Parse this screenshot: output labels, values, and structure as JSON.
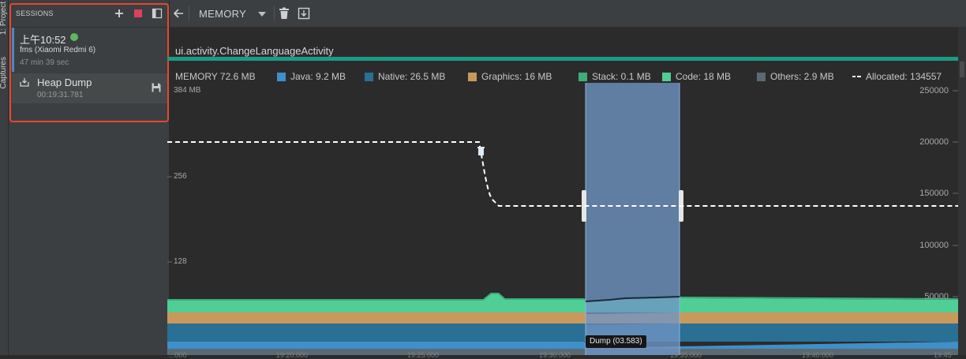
{
  "toolstrip": {
    "tab1": "1: Project",
    "tab2": "Captures"
  },
  "sessions": {
    "title": "SESSIONS",
    "session": {
      "time": "上午10:52",
      "device": "fms (Xiaomi Redmi 6)",
      "duration": "47 min 39 sec"
    },
    "heap_dump": {
      "label": "Heap Dump",
      "timestamp": "00:19:31.781"
    }
  },
  "toolbar": {
    "profiler": "MEMORY"
  },
  "activity": {
    "name": "ui.activity.ChangeLanguageActivity"
  },
  "legend": {
    "total": "MEMORY 72.6 MB",
    "items": [
      {
        "label": "Java: 9.2 MB",
        "color": "#3f8fc9"
      },
      {
        "label": "Native: 26.5 MB",
        "color": "#2a6f94"
      },
      {
        "label": "Graphics: 16 MB",
        "color": "#c9995b"
      },
      {
        "label": "Stack: 0.1 MB",
        "color": "#3cae7a"
      },
      {
        "label": "Code: 18 MB",
        "color": "#4fcf95"
      },
      {
        "label": "Others: 2.9 MB",
        "color": "#5b6a72"
      },
      {
        "label": "Allocated: 134557",
        "color": "#ffffff"
      }
    ]
  },
  "axis_left": [
    "384 MB",
    "256",
    "128"
  ],
  "axis_right": [
    "250000",
    "200000",
    "150000",
    "100000",
    "50000"
  ],
  "x_ticks": [
    "...000",
    "19:20.000",
    "19:25.000",
    "19:30.000",
    "19:35.000",
    "19:40.000",
    "19:45"
  ],
  "tooltip": "Dump (03.583)",
  "colors": {
    "accent": "#1d9a86",
    "selection": "#6f95c4",
    "highlight": "#e8472e"
  }
}
